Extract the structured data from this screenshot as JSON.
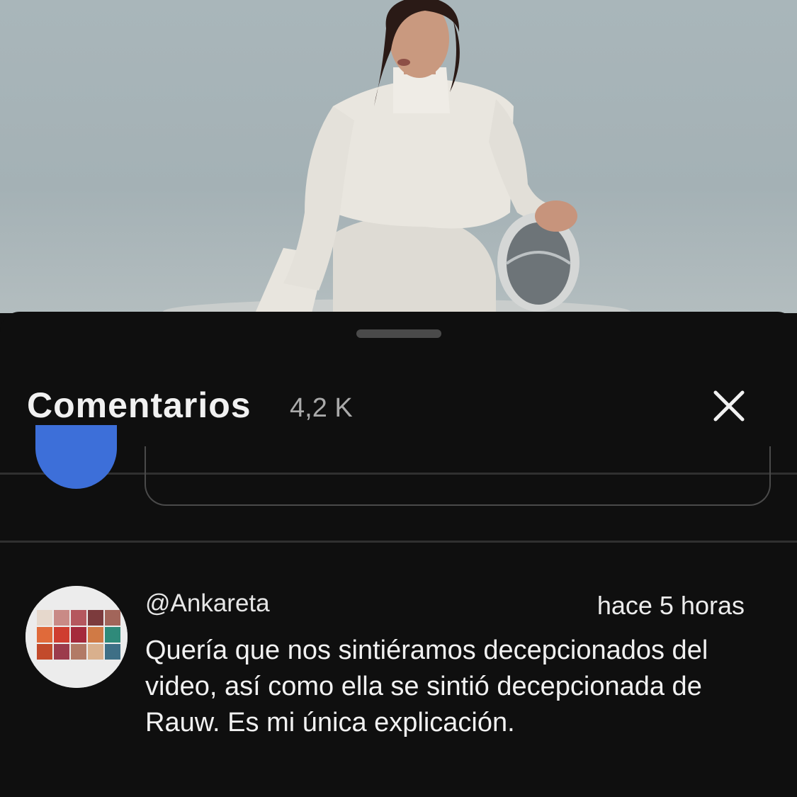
{
  "video": {
    "description_icon": "video-thumbnail"
  },
  "sheet": {
    "title": "Comentarios",
    "count": "4,2 K",
    "close_icon": "close-icon"
  },
  "comment": {
    "author": "@Ankareta",
    "time": "hace 5 horas",
    "text": "Quería que nos sintiéramos decepcionados del video, así como ella se sintió decepcionada de Rauw. Es mi única explicación."
  },
  "colors": {
    "background": "#0f0f0f",
    "user_avatar": "#3d6fd9",
    "divider": "#303030"
  }
}
